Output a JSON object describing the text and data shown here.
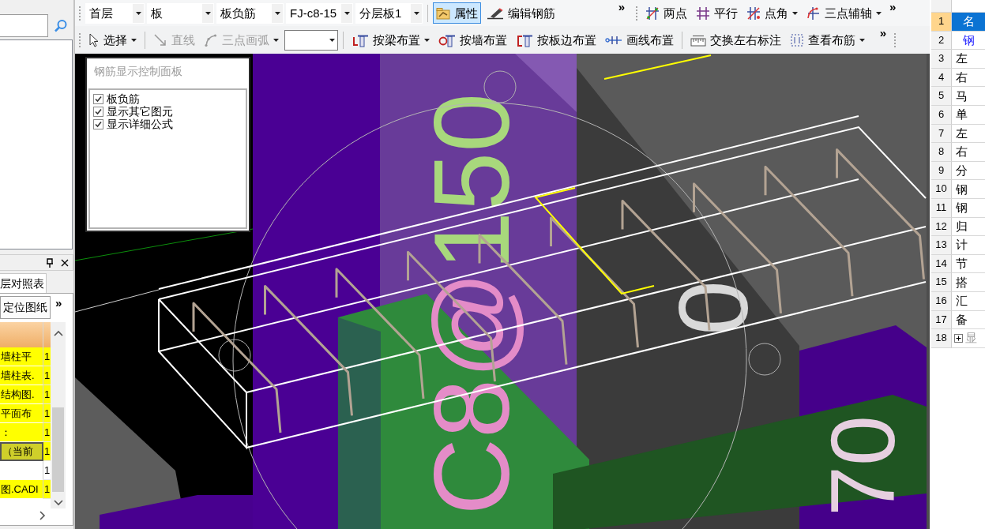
{
  "left_panel": {
    "tabs": [
      {
        "label": "层对照表",
        "selected": true
      }
    ],
    "toolbar": {
      "buttons": [
        {
          "label": "定位图纸"
        }
      ],
      "overflow": "»"
    },
    "table": {
      "rows": [
        {
          "name": "墙柱平",
          "value": "1",
          "highlighted": true,
          "selected": false
        },
        {
          "name": "墙柱表.",
          "value": "1",
          "highlighted": true,
          "selected": false
        },
        {
          "name": "结构图.",
          "value": "1",
          "highlighted": true,
          "selected": false
        },
        {
          "name": "平面布",
          "value": "1",
          "highlighted": true,
          "selected": false
        },
        {
          "name": "：",
          "value": "1",
          "highlighted": true,
          "selected": false
        },
        {
          "name": "（当前",
          "value": "1",
          "highlighted": true,
          "selected": true
        },
        {
          "value": "1",
          "highlighted": false,
          "selected": false
        },
        {
          "name": "图.CADI",
          "value": "1",
          "highlighted": true,
          "selected": false
        }
      ]
    }
  },
  "toolbar_rows": [
    [
      {
        "items": [
          {
            "kind": "combo",
            "value": "首层"
          },
          {
            "kind": "combo",
            "value": "板"
          },
          {
            "kind": "combo",
            "value": "板负筋"
          },
          {
            "kind": "combo",
            "value": "FJ-c8-15"
          },
          {
            "kind": "combo",
            "value": "分层板1"
          },
          {
            "kind": "separator"
          },
          {
            "kind": "button",
            "label": "属性",
            "selected": true,
            "disabled": false,
            "dropdown": false
          },
          {
            "kind": "button",
            "label": "编辑钢筋",
            "selected": false,
            "disabled": false,
            "dropdown": false
          }
        ],
        "overflow": "»"
      },
      {
        "items": [
          {
            "kind": "button",
            "label": "两点",
            "selected": false,
            "disabled": false,
            "dropdown": false
          },
          {
            "kind": "button",
            "label": "平行",
            "selected": false,
            "disabled": false,
            "dropdown": false
          },
          {
            "kind": "button",
            "label": "点角",
            "selected": false,
            "disabled": false,
            "dropdown": true
          },
          {
            "kind": "button",
            "label": "三点辅轴",
            "selected": false,
            "disabled": false,
            "dropdown": true
          }
        ],
        "overflow": "»"
      }
    ],
    [
      {
        "items": [
          {
            "kind": "button",
            "label": "选择",
            "selected": false,
            "disabled": false,
            "dropdown": true
          },
          {
            "kind": "separator"
          },
          {
            "kind": "button",
            "label": "直线",
            "selected": false,
            "disabled": true,
            "dropdown": false
          },
          {
            "kind": "button",
            "label": "三点画弧",
            "selected": false,
            "disabled": true,
            "dropdown": true
          },
          {
            "kind": "combo"
          },
          {
            "kind": "separator"
          },
          {
            "kind": "button",
            "label": "按梁布置",
            "selected": false,
            "disabled": false,
            "dropdown": true
          },
          {
            "kind": "button",
            "label": "按墙布置",
            "selected": false,
            "disabled": false,
            "dropdown": false
          },
          {
            "kind": "button",
            "label": "按板边布置",
            "selected": false,
            "disabled": false,
            "dropdown": false
          },
          {
            "kind": "button",
            "label": "画线布置",
            "selected": false,
            "disabled": false,
            "dropdown": false
          },
          {
            "kind": "separator"
          },
          {
            "kind": "button",
            "label": "交换左右标注",
            "selected": false,
            "disabled": false,
            "dropdown": false
          },
          {
            "kind": "button",
            "label": "查看布筋",
            "selected": false,
            "disabled": false,
            "dropdown": true
          }
        ],
        "overflow": "»"
      }
    ]
  ],
  "canvas": {
    "control_panel": {
      "title": "钢筋显示控制面板",
      "options": [
        {
          "label": "板负筋",
          "checked": true
        },
        {
          "label": "显示其它图元",
          "checked": true
        },
        {
          "label": "显示详细公式",
          "checked": true
        }
      ]
    },
    "labels": [
      {
        "text": "C8@150"
      },
      {
        "text": "0"
      },
      {
        "text": "70"
      }
    ]
  },
  "property_grid": {
    "rows": [
      {
        "number": "1",
        "name": "名",
        "kind": "title",
        "selected": true
      },
      {
        "number": "2",
        "name": "钢",
        "kind": "emphasis",
        "selected": false
      },
      {
        "number": "3",
        "name": "左",
        "kind": "plain",
        "selected": false
      },
      {
        "number": "4",
        "name": "右",
        "kind": "plain",
        "selected": false
      },
      {
        "number": "5",
        "name": "马",
        "kind": "plain",
        "selected": false
      },
      {
        "number": "6",
        "name": "单",
        "kind": "plain",
        "selected": false
      },
      {
        "number": "7",
        "name": "左",
        "kind": "plain",
        "selected": false
      },
      {
        "number": "8",
        "name": "右",
        "kind": "plain",
        "selected": false
      },
      {
        "number": "9",
        "name": "分",
        "kind": "plain",
        "selected": false
      },
      {
        "number": "10",
        "name": "钢",
        "kind": "plain",
        "selected": false
      },
      {
        "number": "11",
        "name": "钢",
        "kind": "plain",
        "selected": false
      },
      {
        "number": "12",
        "name": "归",
        "kind": "plain",
        "selected": false
      },
      {
        "number": "13",
        "name": "计",
        "kind": "plain",
        "selected": false
      },
      {
        "number": "14",
        "name": "节",
        "kind": "plain",
        "selected": false
      },
      {
        "number": "15",
        "name": "搭",
        "kind": "plain",
        "selected": false
      },
      {
        "number": "16",
        "name": "汇",
        "kind": "plain",
        "selected": false
      },
      {
        "number": "17",
        "name": "备",
        "kind": "plain",
        "selected": false
      },
      {
        "number": "18",
        "name": "显",
        "kind": "group",
        "expanded": false,
        "selected": false
      }
    ]
  }
}
